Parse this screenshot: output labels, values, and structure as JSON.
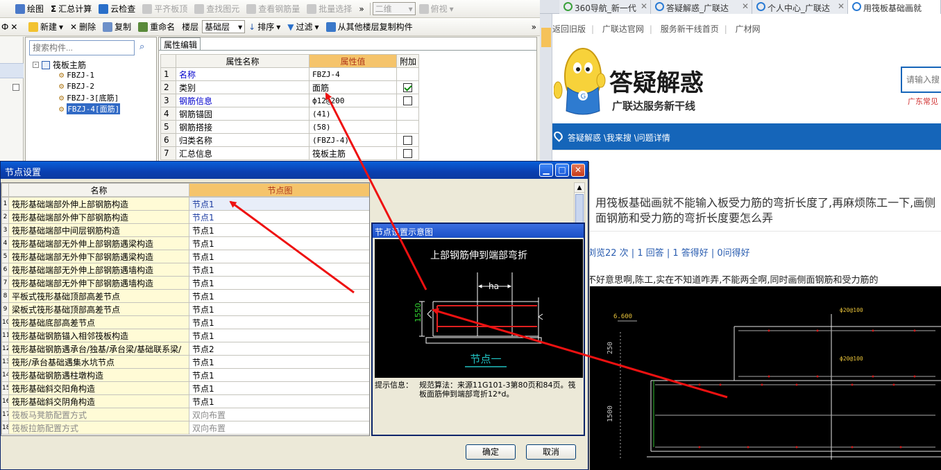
{
  "left_app": {
    "toolbar1": {
      "draw": "绘图",
      "sum_calc": "汇总计算",
      "cloud_check": "云检查",
      "align_slab": "平齐板顶",
      "find_element": "查找图元",
      "view_rebar": "查看钢筋量",
      "batch_select": "批量选择",
      "view_mode": "二维",
      "view_angle": "俯视",
      "more": "»"
    },
    "toolbar2": {
      "new": "新建",
      "delete": "删除",
      "copy": "复制",
      "rename": "重命名",
      "floor_label": "楼层",
      "floor_value": "基础层",
      "sort": "排序",
      "filter": "过滤",
      "copy_from_floor": "从其他楼层复制构件",
      "more": "»"
    },
    "search_placeholder": "搜索构件...",
    "tree": {
      "root": "筏板主筋",
      "items": [
        "FBZJ-1",
        "FBZJ-2",
        "FBZJ-3[底筋]",
        "FBZJ-4[面筋]"
      ]
    },
    "prop_tab": "属性编辑",
    "prop_table": {
      "headers": [
        "属性名称",
        "属性值",
        "附加"
      ],
      "rows": [
        {
          "no": "1",
          "name": "名称",
          "value": "FBZJ-4",
          "check": "none"
        },
        {
          "no": "2",
          "name": "类别",
          "value": "面筋",
          "check": "checked"
        },
        {
          "no": "3",
          "name": "钢筋信息",
          "value": "ф12@200",
          "check": "unchecked"
        },
        {
          "no": "4",
          "name": "钢筋锚固",
          "value": "(41)",
          "check": "none"
        },
        {
          "no": "5",
          "name": "钢筋搭接",
          "value": "(58)",
          "check": "none"
        },
        {
          "no": "6",
          "name": "归类名称",
          "value": "(FBZJ-4)",
          "check": "unchecked"
        },
        {
          "no": "7",
          "name": "汇总信息",
          "value": "筏板主筋",
          "check": "unchecked"
        }
      ]
    }
  },
  "dialog": {
    "title": "节点设置",
    "headers": [
      "名称",
      "节点图"
    ],
    "rows": [
      {
        "no": "1",
        "name": "筏形基础端部外伸上部钢筋构造",
        "node": "节点1"
      },
      {
        "no": "2",
        "name": "筏形基础端部外伸下部钢筋构造",
        "node": "节点1"
      },
      {
        "no": "3",
        "name": "筏形基础端部中间层钢筋构造",
        "node": "节点1"
      },
      {
        "no": "4",
        "name": "筏形基础端部无外伸上部钢筋遇梁构造",
        "node": "节点1"
      },
      {
        "no": "5",
        "name": "筏形基础端部无外伸下部钢筋遇梁构造",
        "node": "节点1"
      },
      {
        "no": "6",
        "name": "筏形基础端部无外伸上部钢筋遇墙构造",
        "node": "节点1"
      },
      {
        "no": "7",
        "name": "筏形基础端部无外伸下部钢筋遇墙构造",
        "node": "节点1"
      },
      {
        "no": "8",
        "name": "平板式筏形基础顶部高差节点",
        "node": "节点1"
      },
      {
        "no": "9",
        "name": "梁板式筏形基础顶部高差节点",
        "node": "节点1"
      },
      {
        "no": "10",
        "name": "筏形基础底部高差节点",
        "node": "节点1"
      },
      {
        "no": "11",
        "name": "筏形基础钢筋锚入相邻筏板构造",
        "node": "节点1"
      },
      {
        "no": "12",
        "name": "筏形基础钢筋遇承台/独基/承台梁/基础联系梁/",
        "node": "节点2"
      },
      {
        "no": "13",
        "name": "筏形/承台基础遇集水坑节点",
        "node": "节点1"
      },
      {
        "no": "14",
        "name": "筏形基础钢筋遇柱墩构造",
        "node": "节点1"
      },
      {
        "no": "15",
        "name": "筏形基础斜交阳角构造",
        "node": "节点1"
      },
      {
        "no": "16",
        "name": "筏形基础斜交阴角构造",
        "node": "节点1"
      },
      {
        "no": "17",
        "name": "筏板马凳筋配置方式",
        "node": "双向布置"
      },
      {
        "no": "18",
        "name": "筏板拉筋配置方式",
        "node": "双向布置"
      }
    ],
    "preview": {
      "title": "节点设置示意图",
      "caption": "上部钢筋伸到端部弯折",
      "dim_ha": "ha",
      "dim_1550": "1550",
      "node_label": "节点一",
      "tip_label": "提示信息：",
      "tip_text": "规范算法：来源11G101-3第80页和84页。筏板面筋伸到端部弯折12*d。"
    },
    "ok": "确定",
    "cancel": "取消"
  },
  "browser": {
    "tabs": [
      "360导航_新一代",
      "答疑解惑_广联达",
      "个人中心_广联达",
      "用筏板基础画就"
    ],
    "nav_links": [
      "返回旧版",
      "广联达官网",
      "服务新干线首页",
      "广材网"
    ],
    "logo_title": "答疑解惑",
    "logo_subtitle": "广联达服务新干线",
    "search_placeholder": "请输入搜",
    "region": "广东常见",
    "breadcrumb": "答疑解惑 \\我来搜 \\问题详情",
    "question": "用筏板基础画就不能输入板受力筋的弯折长度了,再麻烦陈工一下,画侧面钢筋和受力筋的弯折长度要怎么弄",
    "stats": "浏览22 次 | 1 回答 | 1 答得好 | 0问得好",
    "body": "不好意思啊,陈工,实在不知道咋弄,不能两全啊,同时画侧面钢筋和受力筋的",
    "cad": {
      "elev": "6.600",
      "rebar1": "ф20@100",
      "rebar2": "ф20@100",
      "dim1": "250",
      "dim2": "1500"
    }
  }
}
